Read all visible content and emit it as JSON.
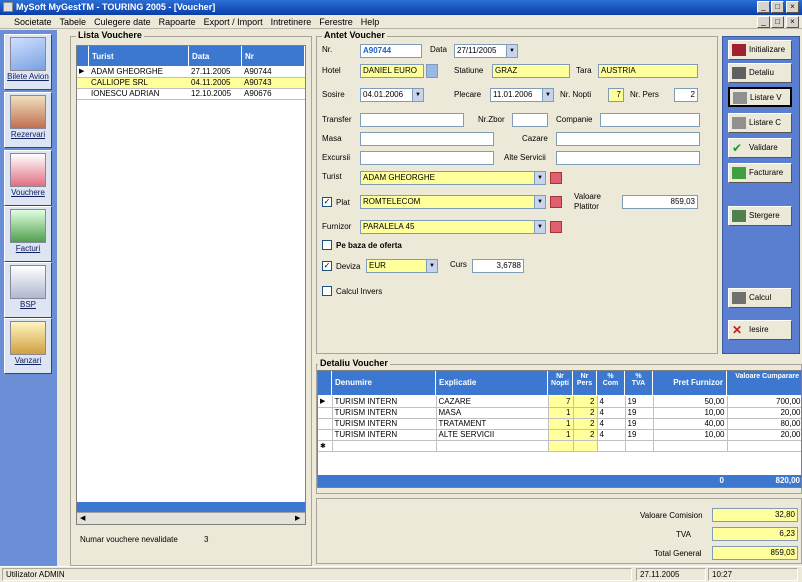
{
  "window": {
    "title": "MySoft MyGestTM - TOURING 2005 - [Voucher]"
  },
  "menu": [
    "Societate",
    "Tabele",
    "Culegere date",
    "Rapoarte",
    "Export / Import",
    "Intretinere",
    "Ferestre",
    "Help"
  ],
  "nav": [
    {
      "label": "Bilete Avion",
      "icon": "airplane-icon"
    },
    {
      "label": "Rezervari",
      "icon": "reservation-icon"
    },
    {
      "label": "Vouchere",
      "icon": "voucher-icon"
    },
    {
      "label": "Facturi",
      "icon": "invoice-icon"
    },
    {
      "label": "BSP",
      "icon": "bsp-icon"
    },
    {
      "label": "Vanzari",
      "icon": "sales-icon"
    }
  ],
  "list": {
    "title": "Lista Vouchere",
    "columns": [
      "Turist",
      "Data",
      "Nr"
    ],
    "rows": [
      {
        "turist": "ADAM GHEORGHE",
        "data": "27.11.2005",
        "nr": "A90744"
      },
      {
        "turist": "CALLIOPE SRL",
        "data": "04.11.2005",
        "nr": "A90743"
      },
      {
        "turist": "IONESCU ADRIAN",
        "data": "12.10.2005",
        "nr": "A90676"
      }
    ],
    "count_label": "Numar vouchere nevalidate",
    "count_value": "3"
  },
  "voucher": {
    "title": "Antet Voucher",
    "nr_label": "Nr.",
    "nr": "A90744",
    "data_label": "Data",
    "data": "27/11/2005",
    "hotel_label": "Hotel",
    "hotel": "DANIEL EURO",
    "statiune_label": "Statiune",
    "statiune": "GRAZ",
    "tara_label": "Tara",
    "tara": "AUSTRIA",
    "sosire_label": "Sosire",
    "sosire": "04.01.2006",
    "plecare_label": "Plecare",
    "plecare": "11.01.2006",
    "nopti_label": "Nr. Nopti",
    "nopti": "7",
    "pers_label": "Nr. Pers",
    "pers": "2",
    "transfer_label": "Transfer",
    "zbor_label": "Nr.Zbor",
    "companie_label": "Companie",
    "masa_label": "Masa",
    "cazare_label": "Cazare",
    "excursii_label": "Excursii",
    "alte_label": "Alte Servicii",
    "turist_label": "Turist",
    "turist": "ADAM GHEORGHE",
    "plat_label": "Plat",
    "plat": "ROMTELECOM",
    "valoare_label": "Valoare Platitor",
    "valoare": "859,03",
    "furnizor_label": "Furnizor",
    "furnizor": "PARALELA 45",
    "oferta_label": "Pe baza de oferta",
    "deviza_label": "Deviza",
    "deviza": "EUR",
    "curs_label": "Curs",
    "curs": "3,6788",
    "calcul_label": "Calcul Invers"
  },
  "actions": [
    {
      "label": "Initializare",
      "icon": "init-icon"
    },
    {
      "label": "Detaliu",
      "icon": "detail-icon"
    },
    {
      "label": "Listare V",
      "icon": "print-icon"
    },
    {
      "label": "Listare C",
      "icon": "print-icon"
    },
    {
      "label": "Validare",
      "icon": "check-icon"
    },
    {
      "label": "Facturare",
      "icon": "invoice-icon"
    },
    {
      "label": "Stergere",
      "icon": "delete-icon"
    },
    {
      "label": "Calcul",
      "icon": "calc-icon"
    },
    {
      "label": "Iesire",
      "icon": "exit-icon"
    }
  ],
  "detail": {
    "title": "Detaliu Voucher",
    "columns": [
      "Denumire",
      "Explicatie",
      "Nr Nopti",
      "Nr Pers",
      "% Com",
      "% TVA",
      "Pret Furnizor",
      "Valoare Cumparare"
    ],
    "rows": [
      [
        "TURISM INTERN",
        "CAZARE",
        "7",
        "2",
        "4",
        "19",
        "50,00",
        "700,00"
      ],
      [
        "TURISM INTERN",
        "MASA",
        "1",
        "2",
        "4",
        "19",
        "10,00",
        "20,00"
      ],
      [
        "TURISM INTERN",
        "TRATAMENT",
        "1",
        "2",
        "4",
        "19",
        "40,00",
        "80,00"
      ],
      [
        "TURISM INTERN",
        "ALTE SERVICII",
        "1",
        "2",
        "4",
        "19",
        "10,00",
        "20,00"
      ]
    ],
    "total_nopti": "0",
    "total_valoare": "820,00"
  },
  "totals": {
    "comision_label": "Valoare Comision",
    "comision": "32,80",
    "tva_label": "TVA",
    "tva": "6,23",
    "general_label": "Total General",
    "general": "859,03"
  },
  "status": {
    "user": "Utilizator ADMIN",
    "date": "27.11.2005",
    "time": "10:27"
  }
}
